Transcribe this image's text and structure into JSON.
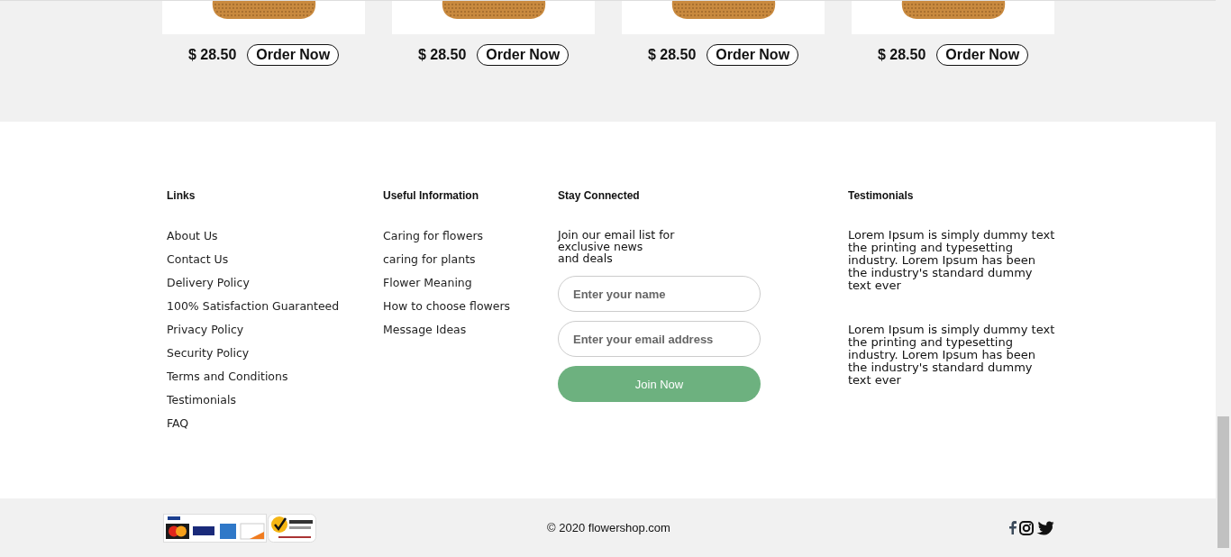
{
  "products": [
    {
      "price": "$ 28.50",
      "button": "Order Now"
    },
    {
      "price": "$ 28.50",
      "button": "Order Now"
    },
    {
      "price": "$ 28.50",
      "button": "Order Now"
    },
    {
      "price": "$ 28.50",
      "button": "Order Now"
    }
  ],
  "footer": {
    "columns": [
      {
        "kind": "links",
        "title": "Links",
        "items": [
          "About Us",
          "Contact Us",
          "Delivery Policy",
          "100% Satisfaction Guaranteed",
          "Privacy Policy",
          "Security Policy",
          "Terms and Conditions",
          "Testimonials",
          "FAQ"
        ]
      },
      {
        "kind": "links",
        "title": "Useful Information",
        "items": [
          "Caring for flowers",
          "caring for plants",
          "Flower Meaning",
          "How to choose flowers",
          "Message Ideas"
        ]
      },
      {
        "kind": "signup",
        "title": "Stay Connected",
        "text": "Join our email list for exclusive news\nand deals",
        "name_placeholder": "Enter your name",
        "email_placeholder": "Enter your email address",
        "button": "Join Now"
      },
      {
        "kind": "testimonials",
        "title": "Testimonials",
        "items": [
          "Lorem Ipsum is simply dummy text the printing and typesetting industry. Lorem Ipsum has been the industry's standard dummy text ever",
          "Lorem Ipsum is simply dummy text the printing and typesetting industry. Lorem Ipsum has been the industry's standard dummy text ever"
        ]
      }
    ]
  },
  "bottom_bar": {
    "copyright": "© 2020 flowershop.com"
  }
}
